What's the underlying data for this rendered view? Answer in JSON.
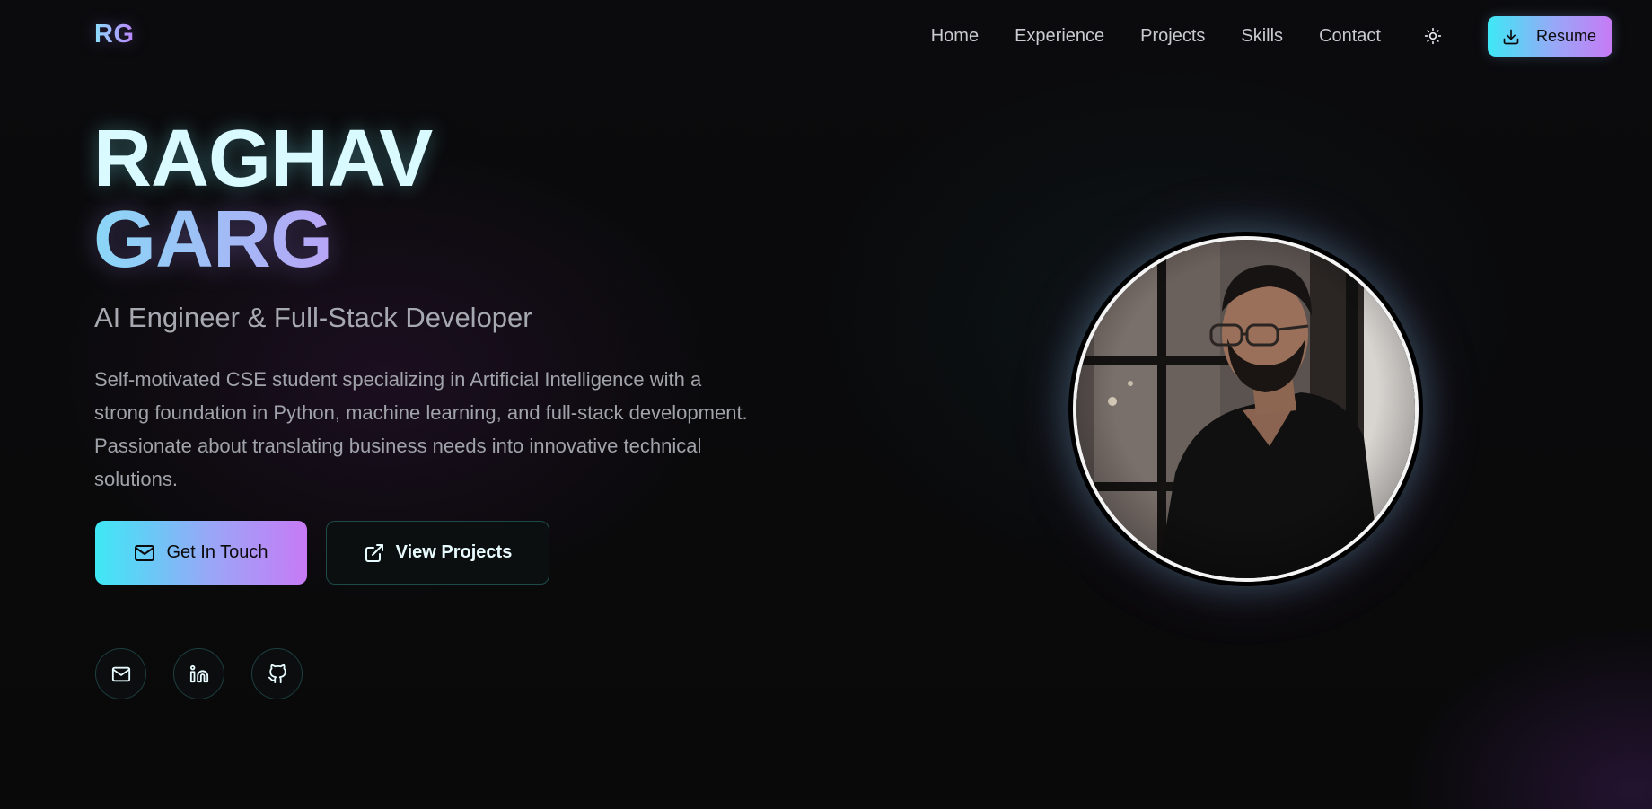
{
  "nav": {
    "logo": "RG",
    "links": [
      "Home",
      "Experience",
      "Projects",
      "Skills",
      "Contact"
    ],
    "theme_icon": "sun-icon",
    "resume_label": "Resume",
    "resume_icon": "download-icon"
  },
  "hero": {
    "first_name": "RAGHAV",
    "last_name": "GARG",
    "subtitle": "AI Engineer & Full-Stack Developer",
    "bio": "Self-motivated CSE student specializing in Artificial Intelligence with a strong foundation in Python, machine learning, and full-stack development. Passionate about translating business needs into innovative technical solutions.",
    "cta_primary": {
      "label": "Get In Touch",
      "icon": "mail-icon"
    },
    "cta_secondary": {
      "label": "View Projects",
      "icon": "external-link-icon"
    },
    "socials": [
      {
        "icon": "mail-icon"
      },
      {
        "icon": "linkedin-icon"
      },
      {
        "icon": "github-icon"
      }
    ]
  },
  "colors": {
    "accent_cyan": "#3ee8f5",
    "accent_purple": "#c77af5",
    "background": "#0a0a0b",
    "text_muted": "#a1a3aa"
  }
}
